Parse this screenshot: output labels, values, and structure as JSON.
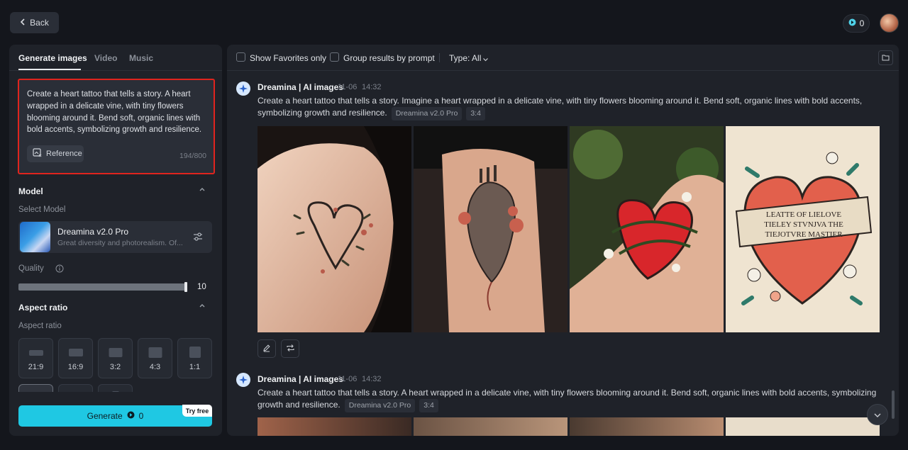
{
  "header": {
    "back_label": "Back",
    "credits": "0"
  },
  "left": {
    "tabs": [
      "Generate images",
      "Video",
      "Music"
    ],
    "prompt": "Create a heart tattoo that tells a story. A heart wrapped in a delicate vine, with tiny flowers blooming around it. Bend soft, organic lines with bold accents, symbolizing growth and resilience.",
    "reference_label": "Reference",
    "char_count": "194/800",
    "model_section": "Model",
    "select_model_label": "Select Model",
    "model_name": "Dreamina v2.0 Pro",
    "model_desc": "Great diversity and photorealism. Of...",
    "quality_label": "Quality",
    "quality_value": "10",
    "aspect_section": "Aspect ratio",
    "aspect_label": "Aspect ratio",
    "aspect_options": [
      "21:9",
      "16:9",
      "3:2",
      "4:3",
      "1:1"
    ],
    "generate_label": "Generate",
    "generate_cost": "0",
    "try_free": "Try free"
  },
  "right": {
    "show_favorites": "Show Favorites only",
    "group_results": "Group results by prompt",
    "type_filter": "Type: All",
    "generations": [
      {
        "source": "Dreamina | AI images",
        "date": "11-06",
        "time": "14:32",
        "prompt": "Create a heart tattoo that tells a story. Imagine a heart wrapped in a delicate vine, with tiny flowers blooming around it. Bend soft, organic lines with bold accents, symbolizing growth and resilience.",
        "model_tag": "Dreamina v2.0 Pro",
        "ratio_tag": "3:4"
      },
      {
        "source": "Dreamina | AI images",
        "date": "11-06",
        "time": "14:32",
        "prompt": "Create a heart tattoo that tells a story. A heart wrapped in a delicate vine, with tiny flowers blooming around it. Bend soft, organic lines with bold accents, symbolizing growth and resilience.",
        "model_tag": "Dreamina v2.0 Pro",
        "ratio_tag": "3:4"
      }
    ],
    "tattoo_text": [
      "LEATTE OF LIELOVE",
      "TIELEY STVNJVA THE",
      "TIEJOTVRE MASTIER"
    ]
  },
  "colors": {
    "accent": "#1fc8e3",
    "highlight_border": "#e0241e",
    "panel_bg": "#1f2229",
    "page_bg": "#14161c"
  }
}
